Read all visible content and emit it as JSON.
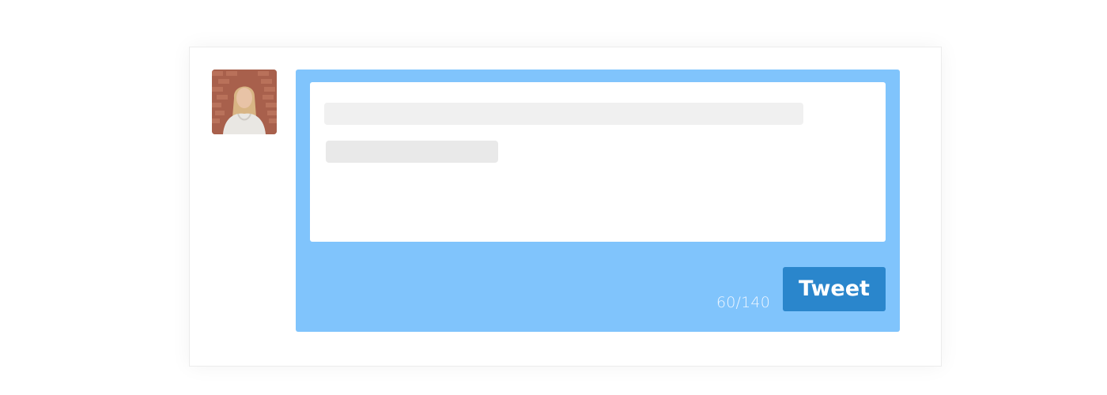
{
  "composer": {
    "avatar_icon": "user-photo",
    "char_count": "60/140",
    "tweet_label": "Tweet",
    "colors": {
      "panel_background": "#80c4fc",
      "button_background": "#2a86cc",
      "skeleton_light": "#f0f0f0",
      "skeleton_dark": "#e9e9e9"
    }
  }
}
